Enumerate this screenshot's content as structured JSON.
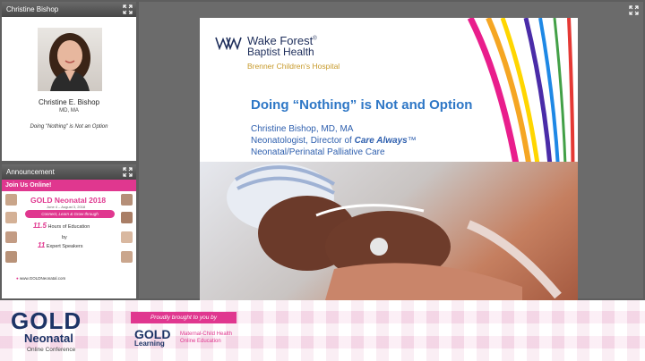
{
  "speaker_panel": {
    "title": "Christine Bishop",
    "name": "Christine E. Bishop",
    "credentials": "MD, MA",
    "talk_title": "Doing \"Nothing\" is Not an Option"
  },
  "announcement_panel": {
    "title": "Announcement",
    "banner": "Join Us Online!",
    "event": "GOLD Neonatal 2018",
    "dates": "June 4 – August 3, 2018",
    "tagline": "Connect, Learn & Grow through",
    "hours_number": "11.5",
    "hours_text": "Hours of Education",
    "by": "by",
    "speakers_number": "11",
    "speakers_text": "Expert Speakers",
    "url": "www.GOLDNeonatal.com"
  },
  "slide": {
    "brand_line1": "Wake Forest",
    "brand_reg": "®",
    "brand_line2": "Baptist Health",
    "brand_line3": "Brenner Children's Hospital",
    "title": "Doing “Nothing” is Not and Option",
    "presenter": "Christine Bishop, MD, MA",
    "role_prefix": "Neonatologist, Director of ",
    "role_program": "Care Always",
    "role_tm": "™",
    "department": "Neonatal/Perinatal Palliative Care",
    "stripe_colors": [
      "#e91e8c",
      "#f5a623",
      "#ffd600",
      "#4a2ca8",
      "#1e88e5",
      "#43a047",
      "#e53935"
    ]
  },
  "footer": {
    "gold_logo": "GOLD",
    "neonatal": "Neonatal",
    "online_conference": "Online Conference",
    "brought_by": "Proudly brought to you by",
    "gold_learning_logo": "GOLD",
    "learning": "Learning",
    "desc_line1": "Maternal-Child Health",
    "desc_line2": "Online Education"
  },
  "colors": {
    "accent_pink": "#e0378f",
    "navy": "#1d3466",
    "slide_blue": "#2e77c6"
  }
}
